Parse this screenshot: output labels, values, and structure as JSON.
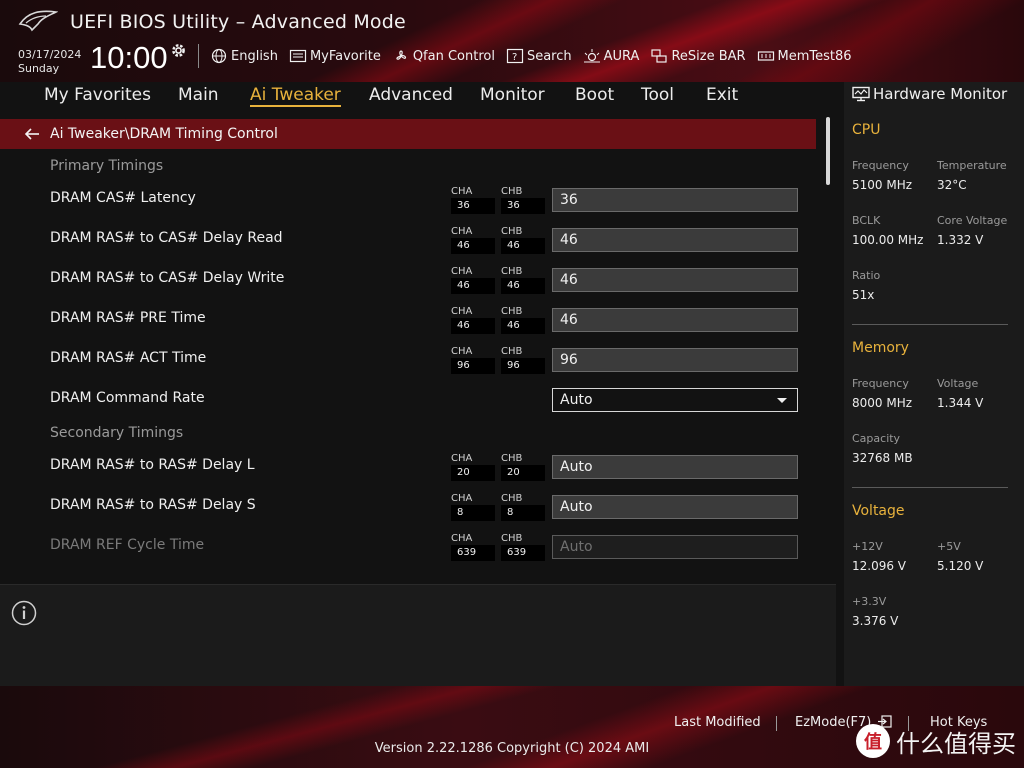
{
  "header": {
    "title": "UEFI BIOS Utility – Advanced Mode",
    "date": "03/17/2024",
    "day": "Sunday",
    "time": "10:00",
    "tools": [
      {
        "label": "English",
        "icon": "globe-icon"
      },
      {
        "label": "MyFavorite",
        "icon": "favorite-icon"
      },
      {
        "label": "Qfan Control",
        "icon": "fan-icon"
      },
      {
        "label": "Search",
        "icon": "search-icon"
      },
      {
        "label": "AURA",
        "icon": "aura-icon"
      },
      {
        "label": "ReSize BAR",
        "icon": "resize-bar-icon"
      },
      {
        "label": "MemTest86",
        "icon": "memtest-icon"
      }
    ]
  },
  "nav": {
    "items": [
      "My Favorites",
      "Main",
      "Ai Tweaker",
      "Advanced",
      "Monitor",
      "Boot",
      "Tool",
      "Exit"
    ],
    "active": "Ai Tweaker"
  },
  "main": {
    "breadcrumb": "Ai Tweaker\\DRAM Timing Control",
    "primary_title": "Primary Timings",
    "secondary_title": "Secondary Timings",
    "channel_a": "CHA",
    "channel_b": "CHB",
    "rows": [
      {
        "label": "DRAM CAS# Latency",
        "cha": "36",
        "chb": "36",
        "value": "36"
      },
      {
        "label": "DRAM RAS# to CAS# Delay Read",
        "cha": "46",
        "chb": "46",
        "value": "46"
      },
      {
        "label": "DRAM RAS# to CAS# Delay Write",
        "cha": "46",
        "chb": "46",
        "value": "46"
      },
      {
        "label": "DRAM RAS# PRE Time",
        "cha": "46",
        "chb": "46",
        "value": "46"
      },
      {
        "label": "DRAM RAS# ACT Time",
        "cha": "96",
        "chb": "96",
        "value": "96"
      },
      {
        "label": "DRAM Command Rate",
        "value": "Auto"
      },
      {
        "label": "DRAM RAS# to RAS# Delay L",
        "cha": "20",
        "chb": "20",
        "value": "Auto"
      },
      {
        "label": "DRAM RAS# to RAS# Delay S",
        "cha": "8",
        "chb": "8",
        "value": "Auto"
      },
      {
        "label": "DRAM REF Cycle Time",
        "cha": "639",
        "chb": "639",
        "value": "Auto"
      }
    ]
  },
  "hardware_monitor": {
    "title": "Hardware Monitor",
    "cpu": {
      "heading": "CPU",
      "frequency_label": "Frequency",
      "frequency": "5100 MHz",
      "temperature_label": "Temperature",
      "temperature": "32°C",
      "bclk_label": "BCLK",
      "bclk": "100.00 MHz",
      "core_voltage_label": "Core Voltage",
      "core_voltage": "1.332 V",
      "ratio_label": "Ratio",
      "ratio": "51x"
    },
    "memory": {
      "heading": "Memory",
      "frequency_label": "Frequency",
      "frequency": "8000 MHz",
      "voltage_label": "Voltage",
      "voltage": "1.344 V",
      "capacity_label": "Capacity",
      "capacity": "32768 MB"
    },
    "voltage": {
      "heading": "Voltage",
      "v12_label": "+12V",
      "v12": "12.096 V",
      "v5_label": "+5V",
      "v5": "5.120 V",
      "v33_label": "+3.3V",
      "v33": "3.376 V"
    }
  },
  "footer": {
    "last_modified": "Last Modified",
    "ezmode": "EzMode(F7)",
    "hot_keys": "Hot Keys",
    "version": "Version 2.22.1286 Copyright (C) 2024 AMI",
    "watermark": "什么值得买"
  },
  "colors": {
    "accent": "#e8b23c",
    "breadcrumb_bg": "#6a1015",
    "panel_bg": "#1b1b1b"
  }
}
